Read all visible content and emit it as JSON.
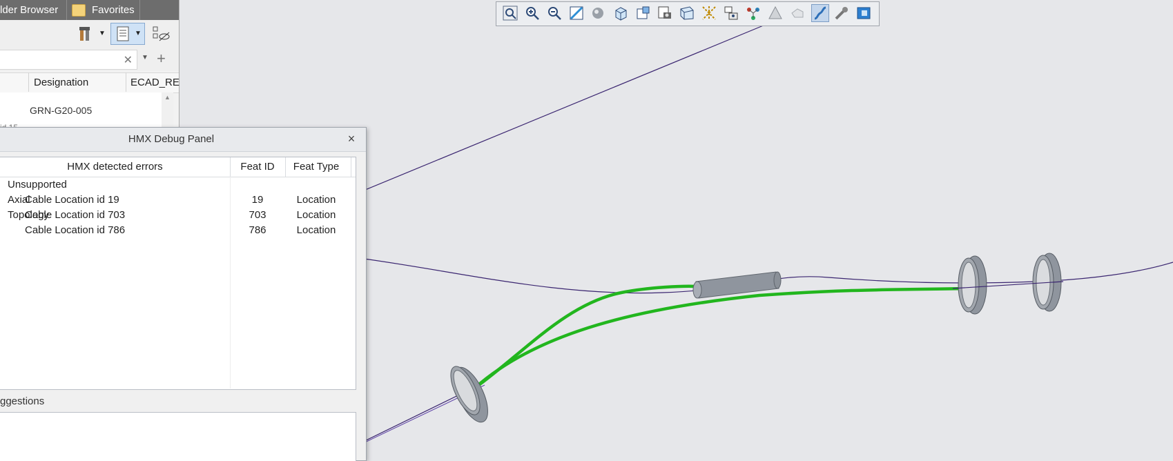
{
  "tabs": {
    "folder_browser": "lder Browser",
    "favorites": "Favorites"
  },
  "tree": {
    "columns": {
      "designation": "Designation",
      "ecad": "ECAD_RE"
    },
    "row_value": "GRN-G20-005",
    "partial_label": "id 15"
  },
  "debug_panel": {
    "title": "HMX Debug Panel",
    "close": "×",
    "columns": {
      "errors": "HMX detected errors",
      "feat_id": "Feat ID",
      "feat_type": "Feat Type"
    },
    "group_label": "Unsupported Axial Topology",
    "rows": [
      {
        "label": "Cable Location id 19",
        "id": "19",
        "type": "Location"
      },
      {
        "label": "Cable Location id 703",
        "id": "703",
        "type": "Location"
      },
      {
        "label": "Cable Location id 786",
        "id": "786",
        "type": "Location"
      }
    ],
    "suggestions_label": "ggestions"
  },
  "colors": {
    "cable_green": "#22b61e",
    "wire_purple": "#3a2570",
    "component_gray": "#8f959e"
  },
  "view_toolbar_icons": [
    "zoom-fit-icon",
    "zoom-in-icon",
    "zoom-out-icon",
    "repaint-icon",
    "display-style-icon",
    "named-views-icon",
    "saved-orientations-icon",
    "view-manager-icon",
    "perspective-icon",
    "datum-display-icon",
    "annotation-display-icon",
    "spin-center-icon",
    "axis-display-icon",
    "csys-display-icon",
    "plane-display-icon",
    "cable-display-icon",
    "harness-display-icon",
    "3d-notes-icon"
  ]
}
